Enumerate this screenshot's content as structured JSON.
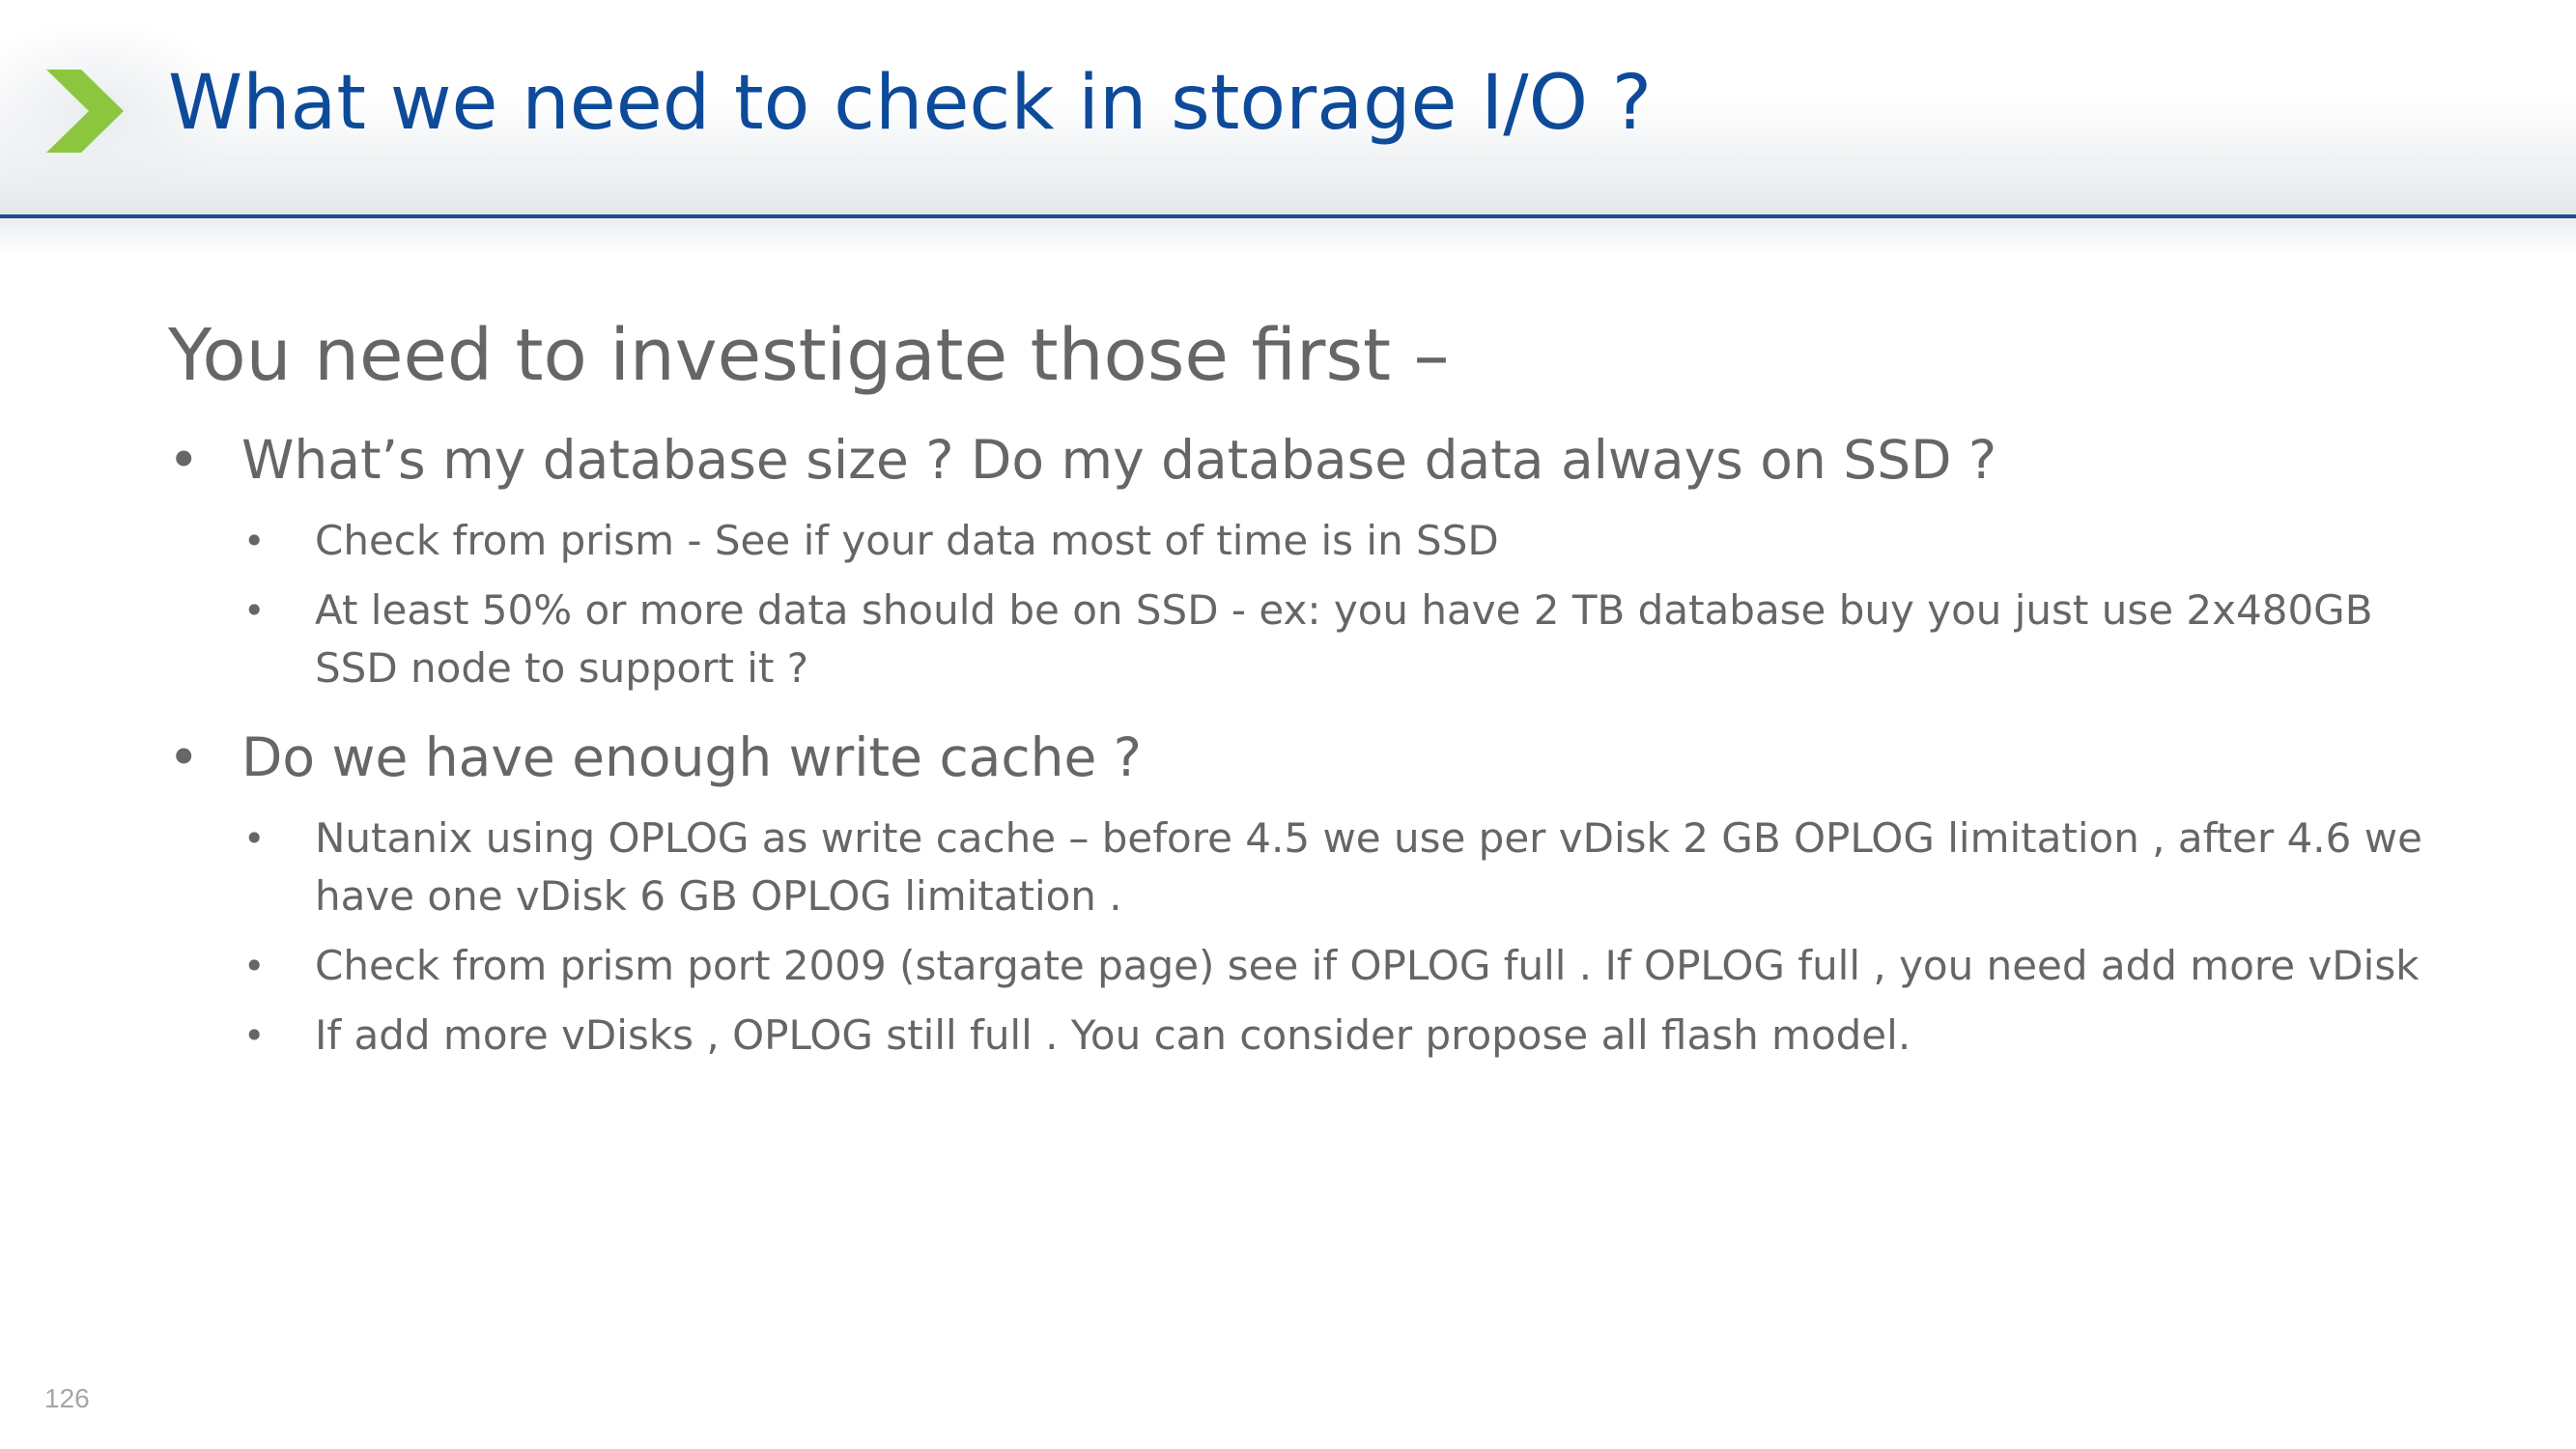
{
  "slide": {
    "title": "What we need to check in storage I/O ?",
    "lead": "You need to investigate those first –",
    "bullet_char": "•",
    "sections": [
      {
        "heading": "What’s my database size  ?  Do my database data always on SSD ?",
        "items": [
          "Check from prism  - See if your data most of time is in SSD",
          "At least 50% or more data should be on SSD -  ex: you have 2 TB database buy you just use 2x480GB SSD node to support it ?"
        ]
      },
      {
        "heading": "Do we have enough write cache ?",
        "items": [
          "Nutanix using OPLOG as write cache – before 4.5 we use per vDisk 2 GB OPLOG limitation , after 4.6 we have one vDisk 6 GB OPLOG limitation .",
          "Check from prism port 2009 (stargate page) see if OPLOG full . If OPLOG full , you need add more vDisk",
          "If add more vDisks , OPLOG still full . You can consider propose all flash model."
        ]
      }
    ],
    "page_number": "126"
  },
  "colors": {
    "title": "#0d4b9a",
    "body_text": "#666666",
    "header_rule": "#1f4e8c",
    "chevron": "#8cc63f",
    "page_number": "#a6a6a6"
  },
  "icons": {
    "logo": "chevron-right-icon"
  }
}
